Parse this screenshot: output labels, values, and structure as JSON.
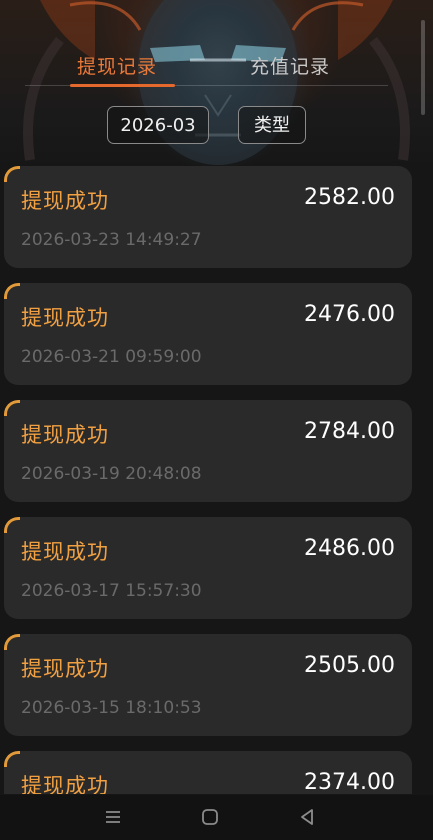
{
  "tabs": [
    {
      "label": "提现记录",
      "active": true
    },
    {
      "label": "充值记录",
      "active": false
    }
  ],
  "filters": {
    "month": "2026-03",
    "type": "类型"
  },
  "records": [
    {
      "status": "提现成功",
      "amount": "2582.00",
      "time": "2026-03-23 14:49:27"
    },
    {
      "status": "提现成功",
      "amount": "2476.00",
      "time": "2026-03-21 09:59:00"
    },
    {
      "status": "提现成功",
      "amount": "2784.00",
      "time": "2026-03-19 20:48:08"
    },
    {
      "status": "提现成功",
      "amount": "2486.00",
      "time": "2026-03-17 15:57:30"
    },
    {
      "status": "提现成功",
      "amount": "2505.00",
      "time": "2026-03-15 18:10:53"
    },
    {
      "status": "提现成功",
      "amount": "2374.00",
      "time": ""
    }
  ],
  "colors": {
    "accent": "#e5682c",
    "status": "#f2a142",
    "card_bg": "#2a2a2a",
    "page_bg": "#161616"
  },
  "nav_icons": [
    "menu-icon",
    "home-icon",
    "back-icon"
  ]
}
